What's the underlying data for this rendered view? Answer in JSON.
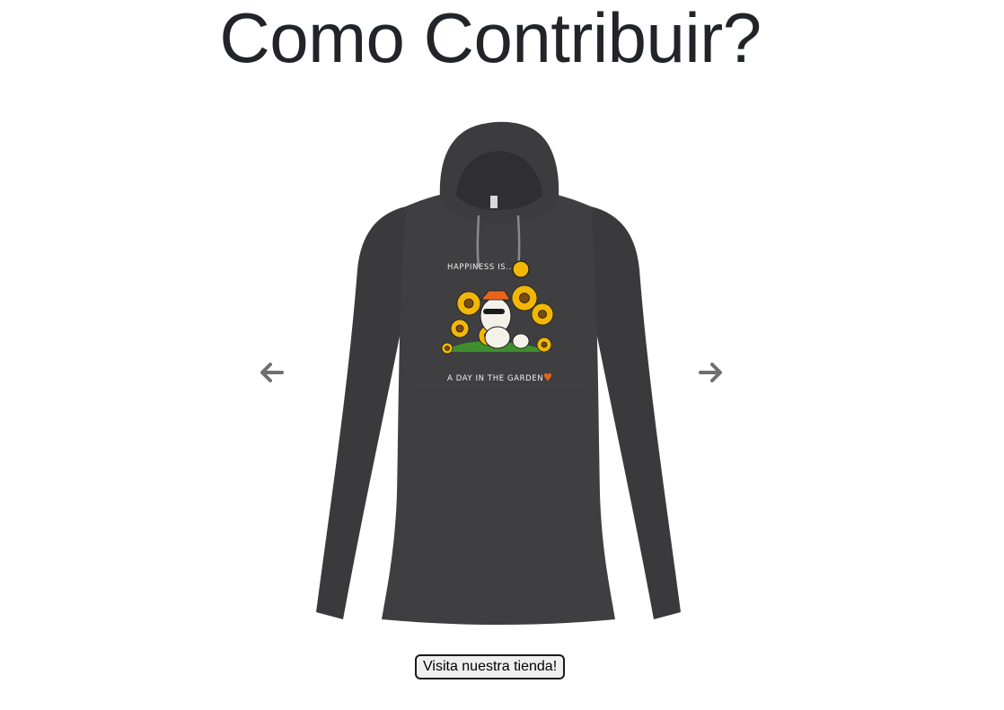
{
  "page": {
    "title": "Como Contribuir?"
  },
  "carousel": {
    "product": {
      "name": "dark heather long-sleeve hooded t-shirt",
      "print_top_text": "HAPPINESS IS...",
      "print_bottom_text": "A DAY IN THE GARDEN",
      "colors": {
        "shirt": "#3d3d40",
        "shirt_shadow": "#2e2e31",
        "sunflower": "#f2b705",
        "sunflower_center": "#7a4a12",
        "hat": "#e8641c",
        "heart": "#e8641c"
      }
    },
    "prev_icon": "arrow-left-icon",
    "next_icon": "arrow-right-icon"
  },
  "store_button": {
    "label": "Visita nuestra tienda!"
  }
}
